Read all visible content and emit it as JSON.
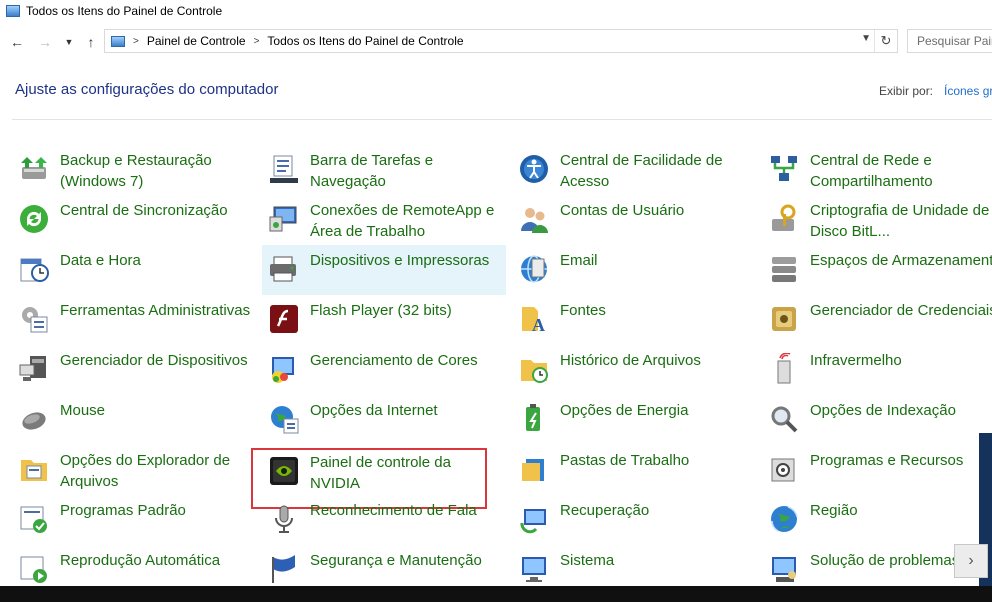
{
  "window": {
    "title": "Todos os Itens do Painel de Controle"
  },
  "nav": {
    "back_icon": "arrow-left-icon",
    "forward_icon": "arrow-right-icon",
    "recent_icon": "chevron-down-icon",
    "up_icon": "arrow-up-icon",
    "breadcrumbs": [
      "Painel de Controle",
      "Todos os Itens do Painel de Controle"
    ],
    "search_placeholder": "Pesquisar Painel de Controle"
  },
  "header": {
    "title": "Ajuste as configurações do computador",
    "view_by_label": "Exibir por:",
    "view_by_value": "Ícones grandes"
  },
  "items": [
    {
      "label": "Backup e Restauração (Windows 7)",
      "icon": "backup-icon"
    },
    {
      "label": "Barra de Tarefas e Navegação",
      "icon": "taskbar-icon"
    },
    {
      "label": "Central de Facilidade de Acesso",
      "icon": "ease-of-access-icon"
    },
    {
      "label": "Central de Rede e Compartilhamento",
      "icon": "network-icon"
    },
    {
      "label": "Central de Sincronização",
      "icon": "sync-icon"
    },
    {
      "label": "Conexões de RemoteApp e Área de Trabalho",
      "icon": "remoteapp-icon"
    },
    {
      "label": "Contas de Usuário",
      "icon": "user-accounts-icon"
    },
    {
      "label": "Criptografia de Unidade de Disco BitL...",
      "icon": "bitlocker-icon"
    },
    {
      "label": "Data e Hora",
      "icon": "date-time-icon"
    },
    {
      "label": "Dispositivos e Impressoras",
      "icon": "devices-printers-icon",
      "state": "hover"
    },
    {
      "label": "Email",
      "icon": "email-icon"
    },
    {
      "label": "Espaços de Armazenamento",
      "icon": "storage-spaces-icon"
    },
    {
      "label": "Ferramentas Administrativas",
      "icon": "admin-tools-icon"
    },
    {
      "label": "Flash Player (32 bits)",
      "icon": "flash-player-icon"
    },
    {
      "label": "Fontes",
      "icon": "fonts-icon"
    },
    {
      "label": "Gerenciador de Credenciais",
      "icon": "credential-manager-icon"
    },
    {
      "label": "Gerenciador de Dispositivos",
      "icon": "device-manager-icon"
    },
    {
      "label": "Gerenciamento de Cores",
      "icon": "color-management-icon"
    },
    {
      "label": "Histórico de Arquivos",
      "icon": "file-history-icon"
    },
    {
      "label": "Infravermelho",
      "icon": "infrared-icon"
    },
    {
      "label": "Mouse",
      "icon": "mouse-icon"
    },
    {
      "label": "Opções da Internet",
      "icon": "internet-options-icon"
    },
    {
      "label": "Opções de Energia",
      "icon": "power-options-icon"
    },
    {
      "label": "Opções de Indexação",
      "icon": "indexing-options-icon"
    },
    {
      "label": "Opções do Explorador de Arquivos",
      "icon": "explorer-options-icon"
    },
    {
      "label": "Painel de controle da NVIDIA",
      "icon": "nvidia-icon",
      "state": "outlined"
    },
    {
      "label": "Pastas de Trabalho",
      "icon": "work-folders-icon"
    },
    {
      "label": "Programas e Recursos",
      "icon": "programs-features-icon"
    },
    {
      "label": "Programas Padrão",
      "icon": "default-programs-icon"
    },
    {
      "label": "Reconhecimento de Fala",
      "icon": "speech-recognition-icon"
    },
    {
      "label": "Recuperação",
      "icon": "recovery-icon"
    },
    {
      "label": "Região",
      "icon": "region-icon"
    },
    {
      "label": "Reprodução Automática",
      "icon": "autoplay-icon"
    },
    {
      "label": "Segurança e Manutenção",
      "icon": "security-maintenance-icon"
    },
    {
      "label": "Sistema",
      "icon": "system-icon"
    },
    {
      "label": "Solução de problemas",
      "icon": "troubleshooting-icon"
    }
  ],
  "colors": {
    "link_green": "#1a6e12",
    "heading_blue": "#1e3287",
    "hover_bg": "#e5f3fb",
    "highlight_red": "#d9363e"
  }
}
